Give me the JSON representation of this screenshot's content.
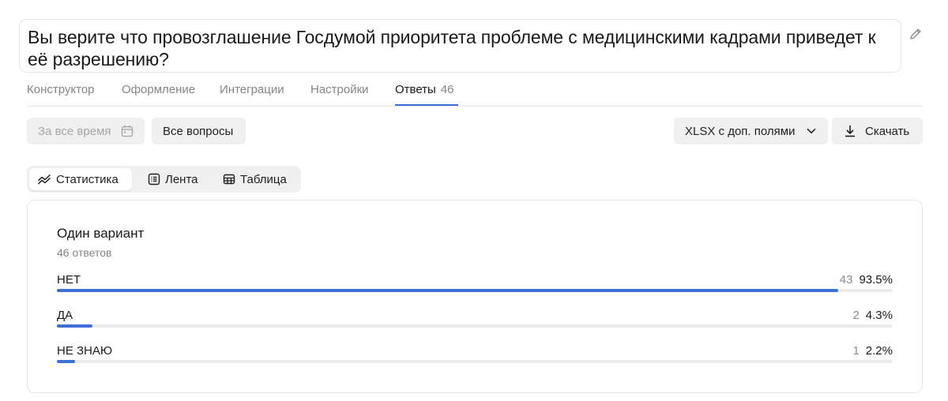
{
  "question": {
    "title": "Вы верите что провозглашение Госдумой приоритета проблеме с медицинскими кадрами приведет к её разрешению?"
  },
  "tabs": [
    {
      "label": "Конструктор",
      "active": false
    },
    {
      "label": "Оформление",
      "active": false
    },
    {
      "label": "Интеграции",
      "active": false
    },
    {
      "label": "Настройки",
      "active": false
    },
    {
      "label": "Ответы",
      "count": "46",
      "active": true
    }
  ],
  "toolbar": {
    "date_placeholder": "За все время",
    "questions_filter": "Все вопросы",
    "export_format": "XLSX с доп. полями",
    "download_label": "Скачать"
  },
  "view_switch": [
    {
      "label": "Статистика",
      "icon": "chart-icon",
      "active": true
    },
    {
      "label": "Лента",
      "icon": "list-icon",
      "active": false
    },
    {
      "label": "Таблица",
      "icon": "table-icon",
      "active": false
    }
  ],
  "stats": {
    "question_type": "Один вариант",
    "answers_count": "46 ответов",
    "options": [
      {
        "label": "НЕТ",
        "count": "43",
        "percent": "93.5%",
        "fraction": 0.935
      },
      {
        "label": "ДА",
        "count": "2",
        "percent": "4.3%",
        "fraction": 0.043
      },
      {
        "label": "НЕ ЗНАЮ",
        "count": "1",
        "percent": "2.2%",
        "fraction": 0.022
      }
    ]
  },
  "colors": {
    "accent": "#3c6fd8",
    "track": "#ebebeb",
    "muted_text": "#858585"
  }
}
